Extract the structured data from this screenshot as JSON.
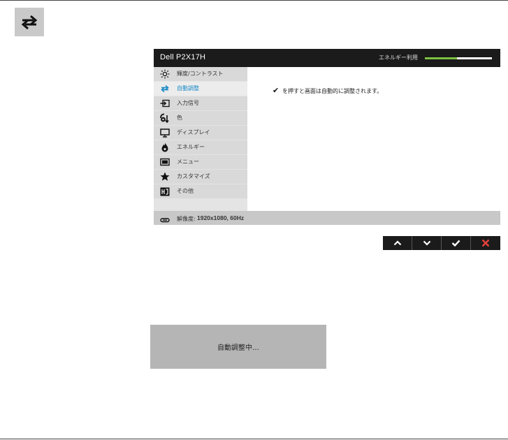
{
  "header": {
    "icon": "auto-adjust-icon"
  },
  "osd": {
    "model": "Dell P2X17H",
    "energy_label": "エネルギー利用",
    "energy_level_percent": 48,
    "colors": {
      "accent": "#1a8ac6",
      "energy": "#7cc242",
      "header_bg": "#1b1b1b"
    },
    "menu": [
      {
        "label": "輝度/コントラスト",
        "icon": "brightness-icon"
      },
      {
        "label": "自動調整",
        "icon": "auto-adjust-icon",
        "selected": true
      },
      {
        "label": "入力信号",
        "icon": "input-source-icon"
      },
      {
        "label": "色",
        "icon": "color-icon"
      },
      {
        "label": "ディスプレイ",
        "icon": "display-icon"
      },
      {
        "label": "エネルギー",
        "icon": "energy-icon"
      },
      {
        "label": "メニュー",
        "icon": "menu-icon"
      },
      {
        "label": "カスタマイズ",
        "icon": "star-icon"
      },
      {
        "label": "その他",
        "icon": "others-icon"
      }
    ],
    "content_text": "を押すと画面は自動的に調整されます。",
    "footer": {
      "resolution_label": "解像度:",
      "resolution_value": "1920x1080, 60Hz"
    }
  },
  "nav_buttons": [
    {
      "icon": "chevron-up-icon"
    },
    {
      "icon": "chevron-down-icon"
    },
    {
      "icon": "check-icon"
    },
    {
      "icon": "close-icon"
    }
  ],
  "progress": {
    "text": "自動調整中…"
  }
}
